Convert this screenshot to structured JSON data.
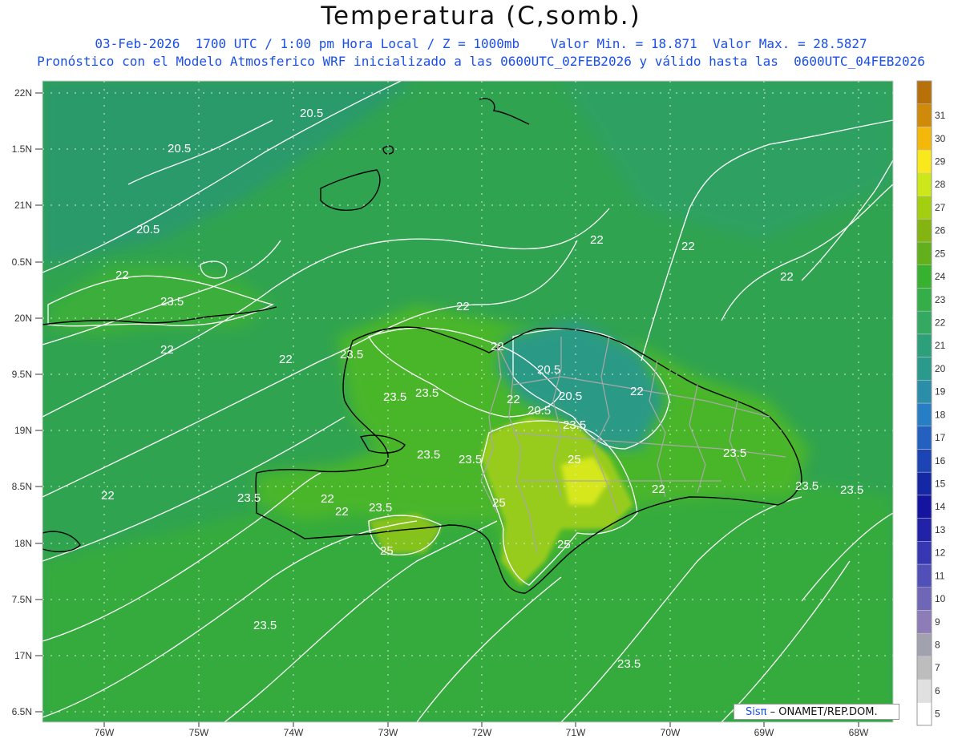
{
  "header": {
    "title": "Temperatura (C,somb.)",
    "subtitle1": "03-Feb-2026  1700 UTC / 1:00 pm Hora Local / Z = 1000mb    Valor Min. = 18.871  Valor Max. = 28.5827",
    "subtitle2": "Pronóstico con el Modelo Atmosferico WRF inicializado a las 0600UTC_02FEB2026 y válido hasta las  0600UTC_04FEB2026"
  },
  "map": {
    "lon_labels": [
      "76W",
      "75W",
      "74W",
      "73W",
      "72W",
      "71W",
      "70W",
      "69W",
      "68W"
    ],
    "lat_labels": [
      "22N",
      "1.5N",
      "21N",
      "0.5N",
      "20N",
      "9.5N",
      "19N",
      "8.5N",
      "18N",
      "7.5N",
      "17N",
      "6.5N"
    ],
    "contour_labels": [
      {
        "text": "20.5"
      },
      {
        "text": "20.5"
      },
      {
        "text": "20.5"
      },
      {
        "text": "22"
      },
      {
        "text": "23.5"
      },
      {
        "text": "22"
      },
      {
        "text": "22"
      },
      {
        "text": "22"
      },
      {
        "text": "22"
      },
      {
        "text": "22"
      },
      {
        "text": "22"
      },
      {
        "text": "23.5"
      },
      {
        "text": "23.5"
      },
      {
        "text": "23.5"
      },
      {
        "text": "22"
      },
      {
        "text": "20.5"
      },
      {
        "text": "20.5"
      },
      {
        "text": "22"
      },
      {
        "text": "20.5"
      },
      {
        "text": "23.5"
      },
      {
        "text": "22"
      },
      {
        "text": "23.5"
      },
      {
        "text": "23.5"
      },
      {
        "text": "25"
      },
      {
        "text": "22"
      },
      {
        "text": "23.5"
      },
      {
        "text": "22"
      },
      {
        "text": "22"
      },
      {
        "text": "23.5"
      },
      {
        "text": "25"
      },
      {
        "text": "25"
      },
      {
        "text": "25"
      },
      {
        "text": "23.5"
      },
      {
        "text": "23.5"
      },
      {
        "text": "23.5"
      },
      {
        "text": "23.5"
      },
      {
        "text": "23.5"
      },
      {
        "text": "22"
      }
    ]
  },
  "colorbar": {
    "labels": [
      "5",
      "6",
      "7",
      "8",
      "9",
      "10",
      "11",
      "12",
      "13",
      "14",
      "15",
      "16",
      "17",
      "18",
      "19",
      "20",
      "21",
      "22",
      "23",
      "24",
      "25",
      "26",
      "27",
      "28",
      "29",
      "30",
      "31"
    ],
    "colors": [
      "#ffffff",
      "#e0e0e0",
      "#bdbdbd",
      "#a2a2ae",
      "#8e7cb8",
      "#6f66b8",
      "#5050b8",
      "#3737b4",
      "#2222a8",
      "#1414a0",
      "#1428a6",
      "#1c44b4",
      "#2460c0",
      "#287ec4",
      "#2a8ea8",
      "#2a9a8c",
      "#2ca07a",
      "#33a962",
      "#34ae48",
      "#36b230",
      "#62b01c",
      "#84b412",
      "#a4ce10",
      "#cce81a",
      "#f8e81c",
      "#f4b80a",
      "#d08a0a",
      "#b87008"
    ]
  },
  "colors": {
    "land_green": "#52b82a",
    "sea_green": "#2fa552",
    "cool_teal": "#2b9a82",
    "warm_yellow": "#bcdc1a",
    "contour": "#ffffff",
    "coast": "#000000",
    "border": "#9a9a9a"
  },
  "credit": {
    "logo": "Sisπ",
    "text": "ONAMET/REP.DOM."
  }
}
